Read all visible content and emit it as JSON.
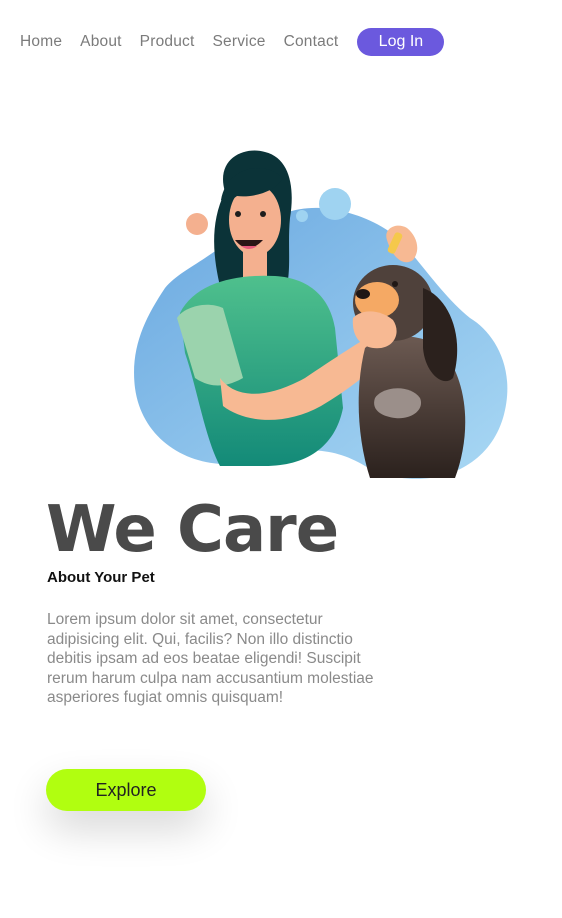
{
  "nav": {
    "items": [
      {
        "label": "Home"
      },
      {
        "label": "About"
      },
      {
        "label": "Product"
      },
      {
        "label": "Service"
      },
      {
        "label": "Contact"
      }
    ],
    "login_label": "Log In"
  },
  "hero": {
    "title": "We Care",
    "subtitle": "About Your Pet",
    "body": "Lorem ipsum dolor sit amet, consectetur adipisicing elit. Qui, facilis? Non illo distinctio debitis ipsam ad eos beatae eligendi! Suscipit rerum harum culpa nam accusantium molestiae asperiores fugiat omnis quisquam!",
    "cta_label": "Explore"
  },
  "colors": {
    "accent": "#6b59de",
    "cta": "#b1fe10",
    "title": "#4a4a4a",
    "body_text": "#8a8a8a",
    "nav_text": "#7b7b7b"
  }
}
